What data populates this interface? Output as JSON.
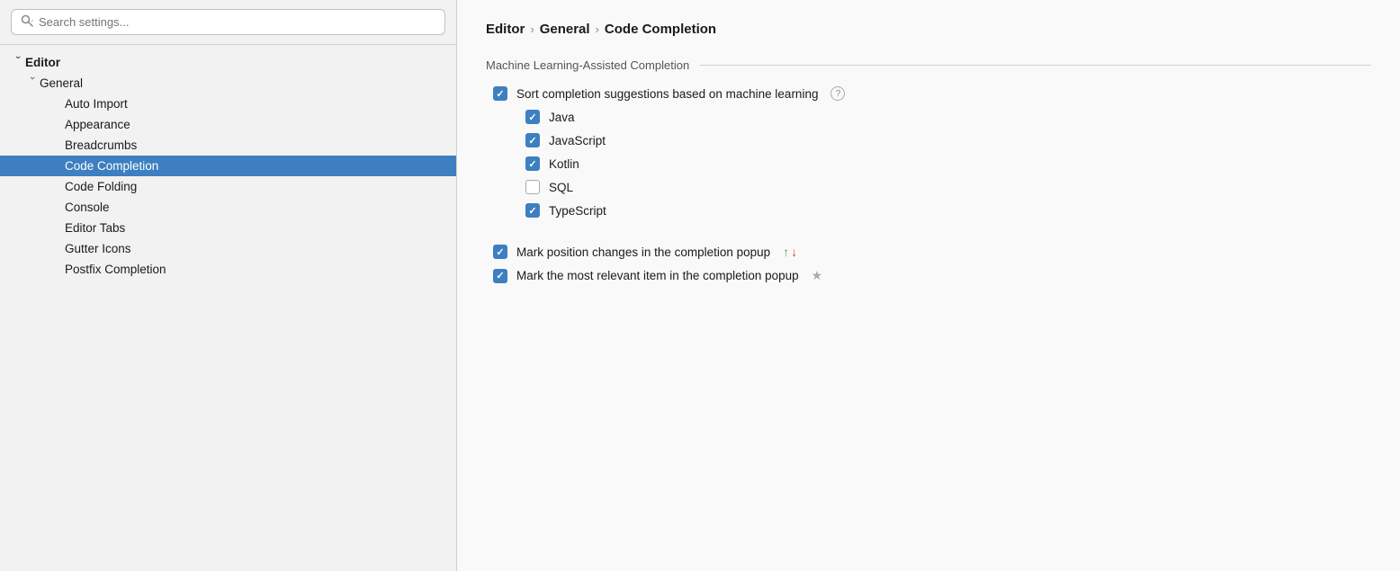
{
  "search": {
    "placeholder": "Search settings...",
    "value": ""
  },
  "sidebar": {
    "tree": [
      {
        "id": "editor",
        "label": "Editor",
        "level": 0,
        "expanded": true,
        "chevron": "›",
        "active": false
      },
      {
        "id": "general",
        "label": "General",
        "level": 1,
        "expanded": true,
        "chevron": "›",
        "active": false
      },
      {
        "id": "auto-import",
        "label": "Auto Import",
        "level": 2,
        "active": false
      },
      {
        "id": "appearance",
        "label": "Appearance",
        "level": 2,
        "active": false
      },
      {
        "id": "breadcrumbs",
        "label": "Breadcrumbs",
        "level": 2,
        "active": false
      },
      {
        "id": "code-completion",
        "label": "Code Completion",
        "level": 2,
        "active": true
      },
      {
        "id": "code-folding",
        "label": "Code Folding",
        "level": 2,
        "active": false
      },
      {
        "id": "console",
        "label": "Console",
        "level": 2,
        "active": false
      },
      {
        "id": "editor-tabs",
        "label": "Editor Tabs",
        "level": 2,
        "active": false
      },
      {
        "id": "gutter-icons",
        "label": "Gutter Icons",
        "level": 2,
        "active": false
      },
      {
        "id": "postfix-completion",
        "label": "Postfix Completion",
        "level": 2,
        "active": false
      }
    ]
  },
  "main": {
    "breadcrumb": {
      "parts": [
        "Editor",
        "General",
        "Code Completion"
      ],
      "separators": [
        "›",
        "›"
      ]
    },
    "section_title": "Machine Learning-Assisted Completion",
    "options": [
      {
        "id": "sort-ml",
        "label": "Sort completion suggestions based on machine learning",
        "checked": true,
        "has_help": true,
        "level": 0
      },
      {
        "id": "java",
        "label": "Java",
        "checked": true,
        "level": 1
      },
      {
        "id": "javascript",
        "label": "JavaScript",
        "checked": true,
        "level": 1
      },
      {
        "id": "kotlin",
        "label": "Kotlin",
        "checked": true,
        "level": 1
      },
      {
        "id": "sql",
        "label": "SQL",
        "checked": false,
        "level": 1
      },
      {
        "id": "typescript",
        "label": "TypeScript",
        "checked": true,
        "level": 1
      }
    ],
    "options2": [
      {
        "id": "mark-position",
        "label": "Mark position changes in the completion popup",
        "checked": true,
        "has_arrows": true
      },
      {
        "id": "mark-relevant",
        "label": "Mark the most relevant item in the completion popup",
        "checked": true,
        "has_star": true
      }
    ]
  }
}
